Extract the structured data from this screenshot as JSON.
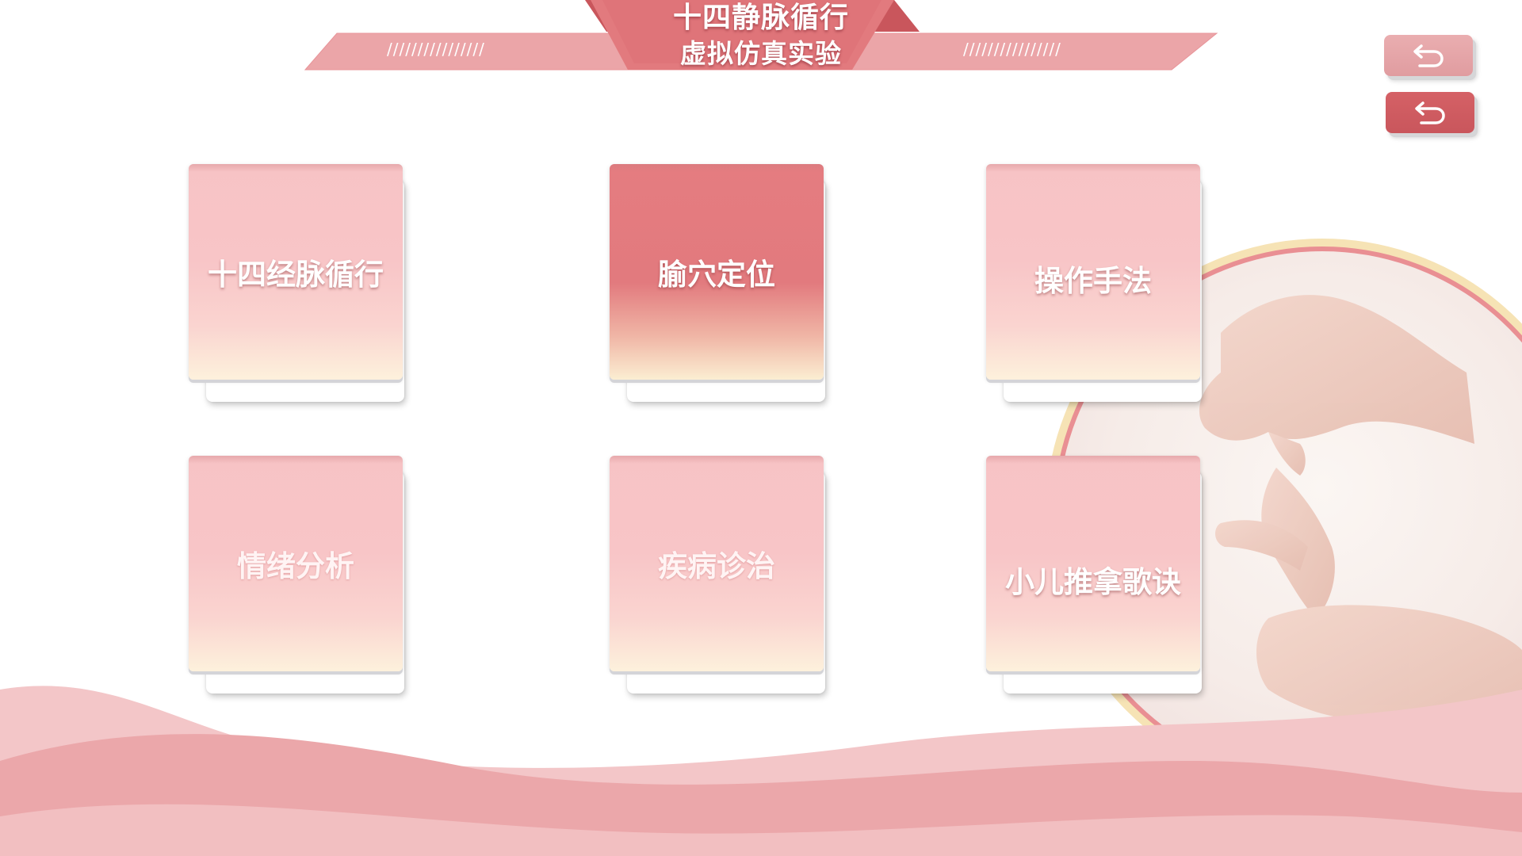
{
  "header": {
    "title_line1": "十四静脉循行",
    "title_line2": "虚拟仿真实验",
    "deco_left": "////////////////",
    "deco_right": "////////////////"
  },
  "nav": {
    "back_icon": "undo-arrow-icon"
  },
  "menu": {
    "items": [
      {
        "label": "十四经脉循行",
        "state": "normal"
      },
      {
        "label": "腧穴定位",
        "state": "active"
      },
      {
        "label": "操作手法",
        "state": "normal"
      },
      {
        "label": "情绪分析",
        "state": "normal"
      },
      {
        "label": "疾病诊治",
        "state": "normal"
      },
      {
        "label": "小儿推拿歌诀",
        "state": "normal"
      }
    ]
  },
  "colors": {
    "accent": "#e27a7e",
    "accent_dark": "#c9565c",
    "card_pink": "#f8c5c7",
    "card_cream": "#fdf1dc",
    "wave_pink": "#eba7aa",
    "ring_red": "#e98f93",
    "ring_gold": "#f6e3b5"
  }
}
